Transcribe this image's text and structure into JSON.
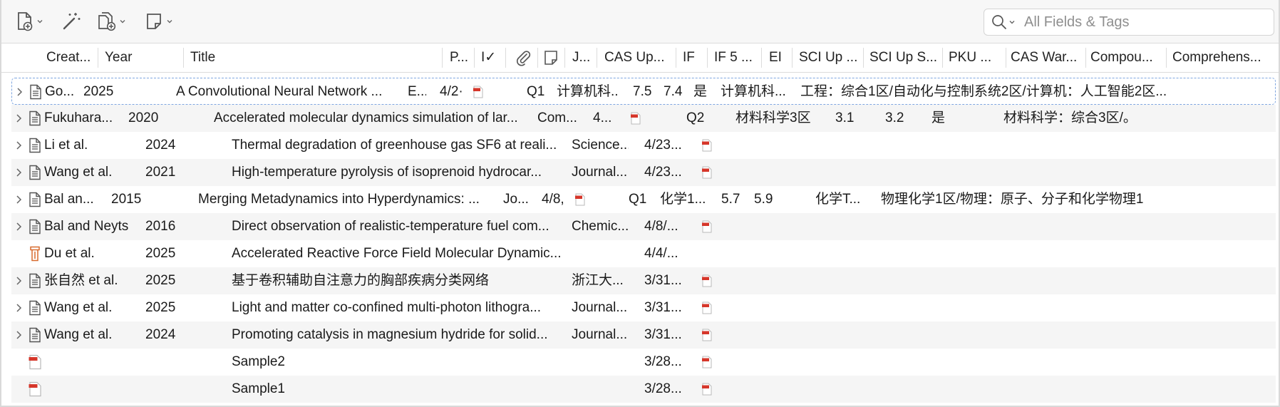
{
  "search": {
    "placeholder": "All Fields & Tags",
    "value": ""
  },
  "toolbar": {
    "icons": [
      "new-item-icon",
      "magic-wand-icon",
      "add-attachment-icon",
      "new-note-icon",
      "chevron-down-icon",
      "search-icon"
    ]
  },
  "columns": {
    "creator": "Creat...",
    "year": "Year",
    "title": "Title",
    "publisher": "P...",
    "read_status": "I✓",
    "journal": "J...",
    "cas_up": "CAS Up...",
    "if": "IF",
    "if5": "IF 5 ...",
    "ei": "EI",
    "sci_up": "SCI Up ...",
    "sci_up_s": "SCI Up S...",
    "pku": "PKU ...",
    "cas_war": "CAS War...",
    "compound": "Compou...",
    "comprehensive": "Comprehens..."
  },
  "rows": [
    {
      "creator": "Go...",
      "year": "2025",
      "title": "A Convolutional Neural Network ...",
      "journal": "E...",
      "date": "4/2·",
      "quartile": "Q1",
      "cas": "计算机科...",
      "if": "7.5",
      "if5": "7.4",
      "ei": "是",
      "sci_up": "计算机科...",
      "comprehensive": "工程：综合1区/自动化与控制系统2区/计算机：人工智能2区..."
    },
    {
      "creator": "Fukuhara...",
      "year": "2020",
      "title": "Accelerated molecular dynamics simulation of lar...",
      "journal": "Com...",
      "date": "4...",
      "quartile": "Q2",
      "cas": "材料科学3区",
      "if": "3.1",
      "if5": "3.2",
      "ei": "是",
      "comprehensive": "材料科学：综合3区/。"
    },
    {
      "creator": "Li et al.",
      "year": "2024",
      "title": "Thermal degradation of greenhouse gas SF6 at reali...",
      "journal": "Science...",
      "date": "4/23..."
    },
    {
      "creator": "Wang et al.",
      "year": "2021",
      "title": "High-temperature pyrolysis of isoprenoid hydrocar...",
      "journal": "Journal...",
      "date": "4/23..."
    },
    {
      "creator": "Bal an...",
      "year": "2015",
      "title": "Merging Metadynamics into Hyperdynamics: ...",
      "journal": "Jo...",
      "date": "4/8,",
      "quartile": "Q1",
      "cas": "化学1...",
      "if": "5.7",
      "if5": "5.9",
      "sci_up": "化学T...",
      "comprehensive": "物理化学1区/物理：原子、分子和化学物理1..."
    },
    {
      "creator": "Bal and Neyts",
      "year": "2016",
      "title": "Direct observation of realistic-temperature fuel com...",
      "journal": "Chemic...",
      "date": "4/8/..."
    },
    {
      "creator": "Du et al.",
      "year": "2025",
      "title": "Accelerated Reactive Force Field Molecular Dynamic...",
      "journal": "",
      "date": "4/4/..."
    },
    {
      "creator": "张自然 et al.",
      "year": "2025",
      "title": "基于卷积辅助自注意力的胸部疾病分类网络",
      "journal": "浙江大...",
      "date": "3/31..."
    },
    {
      "creator": "Wang et al.",
      "year": "2025",
      "title": "Light and matter co-confined multi-photon lithogra...",
      "journal": "Journal...",
      "date": "3/31..."
    },
    {
      "creator": "Wang et al.",
      "year": "2024",
      "title": "Promoting catalysis in magnesium hydride for solid...",
      "journal": "Journal...",
      "date": "3/31..."
    },
    {
      "creator": "",
      "year": "",
      "title": "Sample2",
      "journal": "",
      "date": "3/28..."
    },
    {
      "creator": "",
      "year": "",
      "title": "Sample1",
      "journal": "",
      "date": "3/28..."
    }
  ],
  "colors": {
    "accent": "#7fa6e0",
    "pdf_red": "#d6362a",
    "book_orange": "#d86b2e"
  }
}
